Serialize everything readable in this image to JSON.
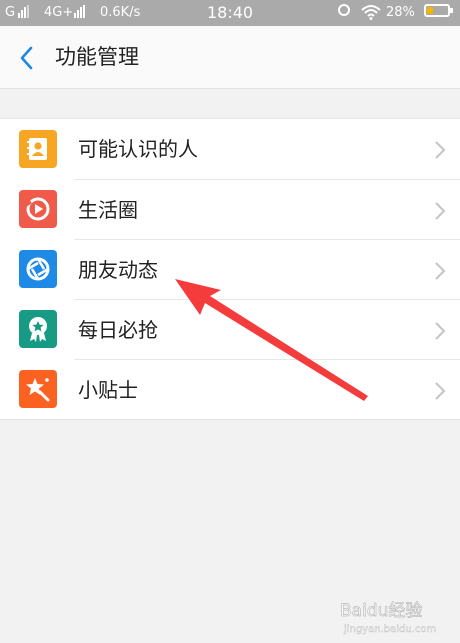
{
  "status_bar": {
    "carrier1": "G",
    "carrier2": "4G+",
    "speed": "0.6K/s",
    "time": "18:40",
    "battery": "28%",
    "battery_level": 0.28
  },
  "header": {
    "title": "功能管理"
  },
  "list": {
    "items": [
      {
        "label": "可能认识的人",
        "icon": "contact-card-icon",
        "color": "#f6a623"
      },
      {
        "label": "生活圈",
        "icon": "life-circle-icon",
        "color": "#ef5a4a"
      },
      {
        "label": "朋友动态",
        "icon": "aperture-icon",
        "color": "#1e8ae6"
      },
      {
        "label": "每日必抢",
        "icon": "ribbon-badge-icon",
        "color": "#179b84"
      },
      {
        "label": "小贴士",
        "icon": "star-wand-icon",
        "color": "#fb6120"
      }
    ]
  },
  "colors": {
    "accent": "#1e88e5",
    "annotation": "#ff2a2a"
  },
  "watermark": {
    "text": "Baidu经验",
    "url": "jingyan.baidu.com"
  }
}
